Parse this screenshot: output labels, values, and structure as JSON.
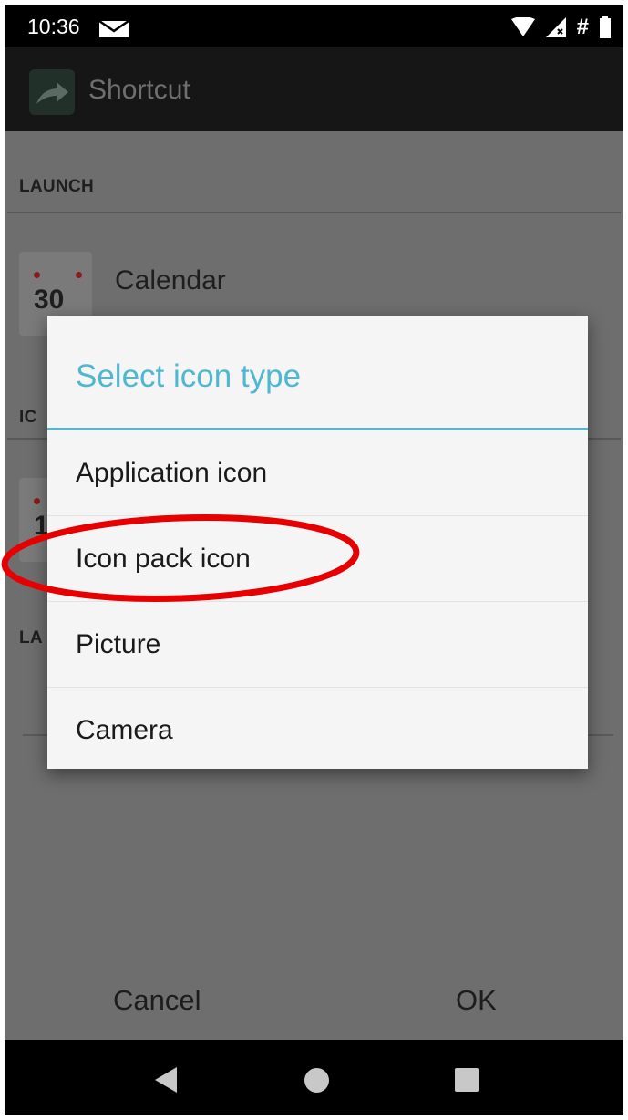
{
  "status_bar": {
    "time": "10:36",
    "icons": [
      "mail-icon",
      "wifi-icon",
      "signal-icon",
      "hash-icon",
      "battery-icon"
    ],
    "hash_symbol": "#"
  },
  "action_bar": {
    "title": "Shortcut",
    "icon": "shortcut-arrow-icon"
  },
  "background": {
    "launch_header": "LAUNCH",
    "launch_item": {
      "title": "Calendar",
      "icon_number": "30"
    },
    "icon_header_partial": "IC",
    "label_header_partial": "LA",
    "icon_item_number_partial": "1",
    "cancel_label": "Cancel",
    "ok_label": "OK"
  },
  "dialog": {
    "title": "Select icon type",
    "options": [
      {
        "label": "Application icon"
      },
      {
        "label": "Icon pack icon"
      },
      {
        "label": "Picture"
      },
      {
        "label": "Camera"
      }
    ],
    "highlighted_option": "Icon pack icon"
  },
  "nav_bar": {
    "buttons": [
      "back-icon",
      "home-icon",
      "recents-icon"
    ]
  },
  "colors": {
    "accent": "#4fb7d2",
    "scrim_background": "#6e6e6e",
    "dialog_background": "#f5f5f5",
    "highlight_ellipse": "#e60000"
  }
}
